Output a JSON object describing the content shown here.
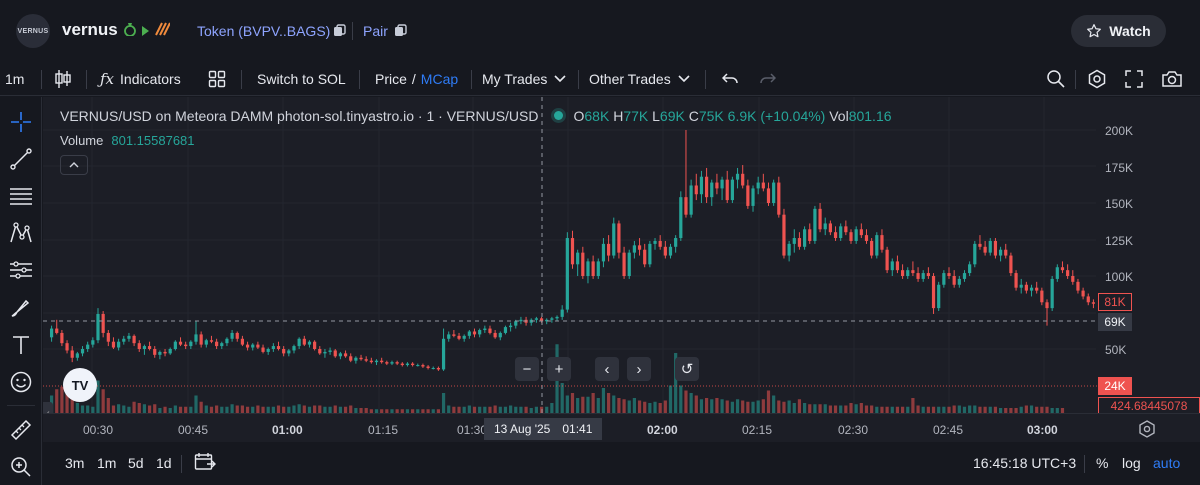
{
  "header": {
    "logo_text": "VERNUS",
    "app_name": "vernus",
    "token_label": "Token (BVPV..BAGS)",
    "pair_label": "Pair",
    "watch_label": "Watch"
  },
  "toolbar": {
    "interval": "1m",
    "indicators_label": "Indicators",
    "switch_label": "Switch to SOL",
    "price_label": "Price",
    "price_sep": "/",
    "mcap_label": "MCap",
    "my_trades_label": "My Trades",
    "other_trades_label": "Other Trades"
  },
  "legend": {
    "symbol": "VERNUS/USD on Meteora DAMM photon-sol.tinyastro.io · 1 · VERNUS/USD",
    "o_key": "O",
    "o_val": "68K",
    "h_key": "H",
    "h_val": "77K",
    "l_key": "L",
    "l_val": "69K",
    "c_key": "C",
    "c_val": "75K",
    "change": "6.9K (+10.04%)",
    "vol_key": "Vol",
    "vol_val": "801.16",
    "volume_label": "Volume",
    "volume_value": "801.15587681"
  },
  "price_axis": {
    "ticks": [
      "200K",
      "175K",
      "150K",
      "125K",
      "100K",
      "50K"
    ],
    "tag_last": "81K",
    "tag_crosshair": "69K",
    "tag_volume_price": "24K",
    "tag_volume": "424.68445078"
  },
  "time_axis": {
    "ticks": [
      "00:30",
      "00:45",
      "01:00",
      "01:15",
      "01:30",
      "02:00",
      "02:15",
      "02:30",
      "02:45",
      "03:00"
    ],
    "crosshair_date": "13 Aug '25",
    "crosshair_time": "01:41"
  },
  "nav": {
    "zoom_out": "−",
    "zoom_in": "+",
    "left": "‹",
    "right": "›",
    "reset": "↺"
  },
  "tv_logo": "TV",
  "bottombar": {
    "ranges": [
      "3m",
      "1m",
      "5d",
      "1d"
    ],
    "clock": "16:45:18 UTC+3",
    "percent": "%",
    "log": "log",
    "auto": "auto"
  },
  "colors": {
    "up": "#26a69a",
    "down": "#ef5350",
    "accent": "#2f7cf6",
    "link": "#8ea4ff"
  },
  "chart_data": {
    "type": "candlestick",
    "y_unit": "USD market cap",
    "ylim": [
      25000,
      210000
    ],
    "ohlc": [
      [
        58000,
        66000,
        55000,
        64000
      ],
      [
        64000,
        70000,
        60000,
        61000
      ],
      [
        61000,
        63000,
        52000,
        54000
      ],
      [
        54000,
        56000,
        47000,
        49000
      ],
      [
        49000,
        52000,
        41000,
        44000
      ],
      [
        44000,
        48000,
        42000,
        47000
      ],
      [
        47000,
        52000,
        45000,
        50000
      ],
      [
        50000,
        55000,
        48000,
        53000
      ],
      [
        53000,
        58000,
        51000,
        56000
      ],
      [
        56000,
        78000,
        54000,
        74000
      ],
      [
        74000,
        76000,
        58000,
        61000
      ],
      [
        61000,
        63000,
        52000,
        55000
      ],
      [
        55000,
        58000,
        50000,
        51000
      ],
      [
        51000,
        57000,
        49000,
        55000
      ],
      [
        55000,
        59000,
        53000,
        57000
      ],
      [
        57000,
        61000,
        55000,
        59000
      ],
      [
        59000,
        60000,
        52000,
        54000
      ],
      [
        54000,
        56000,
        48000,
        50000
      ],
      [
        50000,
        53000,
        46000,
        52000
      ],
      [
        52000,
        55000,
        49000,
        50000
      ],
      [
        50000,
        52000,
        44000,
        46000
      ],
      [
        46000,
        49000,
        43000,
        48000
      ],
      [
        48000,
        50000,
        45000,
        47000
      ],
      [
        47000,
        51000,
        46000,
        50000
      ],
      [
        50000,
        56000,
        49000,
        55000
      ],
      [
        55000,
        58000,
        52000,
        53000
      ],
      [
        53000,
        55000,
        50000,
        52000
      ],
      [
        52000,
        56000,
        50000,
        55000
      ],
      [
        55000,
        69000,
        53000,
        60000
      ],
      [
        60000,
        62000,
        51000,
        53000
      ],
      [
        53000,
        57000,
        51000,
        56000
      ],
      [
        56000,
        59000,
        54000,
        55000
      ],
      [
        55000,
        57000,
        50000,
        52000
      ],
      [
        52000,
        55000,
        50000,
        54000
      ],
      [
        54000,
        58000,
        52000,
        57000
      ],
      [
        57000,
        63000,
        55000,
        61000
      ],
      [
        61000,
        62000,
        55000,
        57000
      ],
      [
        57000,
        59000,
        52000,
        53000
      ],
      [
        53000,
        55000,
        49000,
        51000
      ],
      [
        51000,
        54000,
        49000,
        53000
      ],
      [
        53000,
        55000,
        50000,
        51000
      ],
      [
        51000,
        53000,
        47000,
        48000
      ],
      [
        48000,
        51000,
        46000,
        50000
      ],
      [
        50000,
        54000,
        48000,
        52000
      ],
      [
        52000,
        55000,
        49000,
        50000
      ],
      [
        50000,
        52000,
        45000,
        47000
      ],
      [
        47000,
        50000,
        45000,
        49000
      ],
      [
        49000,
        53000,
        47000,
        52000
      ],
      [
        52000,
        58000,
        50000,
        57000
      ],
      [
        57000,
        59000,
        52000,
        53000
      ],
      [
        53000,
        56000,
        51000,
        55000
      ],
      [
        55000,
        56000,
        49000,
        50000
      ],
      [
        50000,
        52000,
        46000,
        47000
      ],
      [
        47000,
        50000,
        44000,
        48000
      ],
      [
        48000,
        51000,
        46000,
        49000
      ],
      [
        49000,
        50000,
        44000,
        45000
      ],
      [
        45000,
        48000,
        43000,
        47000
      ],
      [
        47000,
        49000,
        44000,
        45000
      ],
      [
        45000,
        47000,
        41000,
        42000
      ],
      [
        42000,
        45000,
        40000,
        44000
      ],
      [
        44000,
        46000,
        42000,
        43000
      ],
      [
        43000,
        45000,
        41000,
        42000
      ],
      [
        42000,
        44000,
        40000,
        41000
      ],
      [
        41000,
        43000,
        39000,
        42000
      ],
      [
        42000,
        44000,
        40000,
        41000
      ],
      [
        41000,
        42000,
        39000,
        40000
      ],
      [
        40000,
        42000,
        39000,
        41000
      ],
      [
        41000,
        42000,
        39000,
        40000
      ],
      [
        40000,
        41000,
        38000,
        39000
      ],
      [
        39000,
        41000,
        38000,
        40000
      ],
      [
        40000,
        41000,
        38000,
        39000
      ],
      [
        39000,
        40000,
        38000,
        39000
      ],
      [
        39000,
        40000,
        37000,
        38000
      ],
      [
        38000,
        39000,
        36000,
        37000
      ],
      [
        37000,
        38000,
        36000,
        37000
      ],
      [
        37000,
        38000,
        35000,
        36000
      ],
      [
        36000,
        64000,
        35000,
        57000
      ],
      [
        57000,
        62000,
        55000,
        60000
      ],
      [
        60000,
        63000,
        58000,
        59000
      ],
      [
        59000,
        61000,
        56000,
        57000
      ],
      [
        57000,
        60000,
        55000,
        59000
      ],
      [
        59000,
        63000,
        57000,
        62000
      ],
      [
        62000,
        64000,
        58000,
        60000
      ],
      [
        60000,
        64000,
        58000,
        63000
      ],
      [
        63000,
        66000,
        61000,
        64000
      ],
      [
        64000,
        66000,
        60000,
        61000
      ],
      [
        61000,
        63000,
        57000,
        58000
      ],
      [
        58000,
        62000,
        56000,
        61000
      ],
      [
        61000,
        66000,
        60000,
        65000
      ],
      [
        65000,
        68000,
        62000,
        66000
      ],
      [
        66000,
        70000,
        64000,
        69000
      ],
      [
        69000,
        72000,
        67000,
        70000
      ],
      [
        70000,
        72000,
        66000,
        68000
      ],
      [
        68000,
        71000,
        66000,
        70000
      ],
      [
        70000,
        72000,
        68000,
        71000
      ],
      [
        71000,
        72000,
        68000,
        69000
      ],
      [
        69000,
        71000,
        67000,
        70000
      ],
      [
        70000,
        72000,
        68000,
        71000
      ],
      [
        71000,
        73000,
        69000,
        72000
      ],
      [
        72000,
        80000,
        70000,
        77000
      ],
      [
        77000,
        130000,
        75000,
        126000
      ],
      [
        126000,
        131000,
        105000,
        108000
      ],
      [
        108000,
        118000,
        100000,
        116000
      ],
      [
        116000,
        120000,
        98000,
        100000
      ],
      [
        100000,
        112000,
        95000,
        110000
      ],
      [
        110000,
        114000,
        98000,
        100000
      ],
      [
        100000,
        112000,
        98000,
        110000
      ],
      [
        110000,
        126000,
        106000,
        122000
      ],
      [
        122000,
        128000,
        110000,
        114000
      ],
      [
        114000,
        140000,
        112000,
        136000
      ],
      [
        136000,
        138000,
        112000,
        116000
      ],
      [
        116000,
        120000,
        98000,
        100000
      ],
      [
        100000,
        118000,
        98000,
        116000
      ],
      [
        116000,
        124000,
        112000,
        121000
      ],
      [
        121000,
        126000,
        114000,
        118000
      ],
      [
        118000,
        122000,
        106000,
        108000
      ],
      [
        108000,
        124000,
        106000,
        122000
      ],
      [
        122000,
        126000,
        118000,
        124000
      ],
      [
        124000,
        128000,
        118000,
        120000
      ],
      [
        120000,
        124000,
        112000,
        114000
      ],
      [
        114000,
        122000,
        112000,
        120000
      ],
      [
        120000,
        128000,
        116000,
        126000
      ],
      [
        126000,
        158000,
        124000,
        154000
      ],
      [
        154000,
        200000,
        140000,
        142000
      ],
      [
        142000,
        166000,
        140000,
        162000
      ],
      [
        162000,
        170000,
        152000,
        156000
      ],
      [
        156000,
        172000,
        150000,
        168000
      ],
      [
        168000,
        174000,
        150000,
        154000
      ],
      [
        154000,
        166000,
        148000,
        164000
      ],
      [
        164000,
        170000,
        156000,
        160000
      ],
      [
        160000,
        168000,
        152000,
        166000
      ],
      [
        166000,
        172000,
        150000,
        152000
      ],
      [
        152000,
        168000,
        150000,
        166000
      ],
      [
        166000,
        174000,
        160000,
        170000
      ],
      [
        170000,
        176000,
        160000,
        162000
      ],
      [
        162000,
        166000,
        146000,
        148000
      ],
      [
        148000,
        162000,
        144000,
        160000
      ],
      [
        160000,
        168000,
        156000,
        164000
      ],
      [
        164000,
        170000,
        158000,
        160000
      ],
      [
        160000,
        164000,
        148000,
        150000
      ],
      [
        150000,
        166000,
        148000,
        164000
      ],
      [
        164000,
        168000,
        140000,
        142000
      ],
      [
        142000,
        146000,
        112000,
        114000
      ],
      [
        114000,
        124000,
        110000,
        122000
      ],
      [
        122000,
        132000,
        116000,
        126000
      ],
      [
        126000,
        130000,
        118000,
        120000
      ],
      [
        120000,
        134000,
        118000,
        132000
      ],
      [
        132000,
        136000,
        122000,
        124000
      ],
      [
        124000,
        148000,
        122000,
        146000
      ],
      [
        146000,
        150000,
        130000,
        132000
      ],
      [
        132000,
        140000,
        128000,
        136000
      ],
      [
        136000,
        138000,
        128000,
        130000
      ],
      [
        130000,
        134000,
        124000,
        126000
      ],
      [
        126000,
        136000,
        124000,
        134000
      ],
      [
        134000,
        138000,
        128000,
        130000
      ],
      [
        130000,
        132000,
        122000,
        124000
      ],
      [
        124000,
        134000,
        122000,
        132000
      ],
      [
        132000,
        136000,
        126000,
        128000
      ],
      [
        128000,
        132000,
        122000,
        124000
      ],
      [
        124000,
        126000,
        112000,
        114000
      ],
      [
        114000,
        130000,
        112000,
        128000
      ],
      [
        128000,
        132000,
        116000,
        118000
      ],
      [
        118000,
        120000,
        102000,
        104000
      ],
      [
        104000,
        112000,
        100000,
        110000
      ],
      [
        110000,
        114000,
        102000,
        104000
      ],
      [
        104000,
        108000,
        98000,
        100000
      ],
      [
        100000,
        106000,
        98000,
        104000
      ],
      [
        104000,
        110000,
        100000,
        102000
      ],
      [
        102000,
        106000,
        96000,
        98000
      ],
      [
        98000,
        104000,
        96000,
        102000
      ],
      [
        102000,
        106000,
        98000,
        100000
      ],
      [
        100000,
        102000,
        74000,
        78000
      ],
      [
        78000,
        96000,
        76000,
        94000
      ],
      [
        94000,
        104000,
        92000,
        102000
      ],
      [
        102000,
        106000,
        98000,
        100000
      ],
      [
        100000,
        104000,
        92000,
        94000
      ],
      [
        94000,
        100000,
        92000,
        98000
      ],
      [
        98000,
        104000,
        96000,
        102000
      ],
      [
        102000,
        110000,
        100000,
        108000
      ],
      [
        108000,
        124000,
        106000,
        122000
      ],
      [
        122000,
        128000,
        118000,
        120000
      ],
      [
        120000,
        124000,
        114000,
        116000
      ],
      [
        116000,
        126000,
        114000,
        124000
      ],
      [
        124000,
        126000,
        112000,
        114000
      ],
      [
        114000,
        120000,
        110000,
        118000
      ],
      [
        118000,
        122000,
        112000,
        114000
      ],
      [
        114000,
        116000,
        100000,
        102000
      ],
      [
        102000,
        104000,
        90000,
        92000
      ],
      [
        92000,
        98000,
        88000,
        94000
      ],
      [
        94000,
        96000,
        88000,
        90000
      ],
      [
        90000,
        94000,
        86000,
        92000
      ],
      [
        92000,
        96000,
        88000,
        90000
      ],
      [
        90000,
        92000,
        80000,
        82000
      ],
      [
        82000,
        84000,
        66000,
        78000
      ],
      [
        78000,
        100000,
        76000,
        98000
      ],
      [
        98000,
        108000,
        96000,
        106000
      ],
      [
        106000,
        110000,
        102000,
        104000
      ],
      [
        104000,
        108000,
        98000,
        100000
      ],
      [
        100000,
        104000,
        94000,
        96000
      ],
      [
        96000,
        98000,
        88000,
        90000
      ],
      [
        90000,
        92000,
        84000,
        86000
      ],
      [
        86000,
        88000,
        80000,
        82000
      ],
      [
        82000,
        84000,
        78000,
        81000
      ]
    ],
    "volume": [
      14,
      19,
      21,
      23,
      11,
      8,
      6,
      6,
      5,
      26,
      19,
      12,
      6,
      7,
      6,
      5,
      9,
      8,
      7,
      6,
      7,
      4,
      5,
      4,
      6,
      5,
      5,
      5,
      14,
      9,
      6,
      5,
      6,
      5,
      5,
      7,
      6,
      6,
      5,
      5,
      6,
      5,
      5,
      5,
      6,
      5,
      5,
      6,
      7,
      6,
      5,
      6,
      6,
      5,
      5,
      6,
      5,
      5,
      6,
      4,
      4,
      4,
      3,
      3,
      3,
      3,
      3,
      3,
      3,
      3,
      3,
      3,
      3,
      3,
      3,
      3,
      16,
      6,
      5,
      5,
      5,
      6,
      5,
      5,
      5,
      5,
      6,
      5,
      5,
      6,
      5,
      5,
      5,
      4,
      5,
      5,
      5,
      8,
      55,
      24,
      14,
      16,
      12,
      13,
      13,
      16,
      12,
      20,
      16,
      14,
      12,
      11,
      10,
      12,
      10,
      9,
      8,
      9,
      8,
      10,
      22,
      48,
      22,
      18,
      16,
      14,
      11,
      12,
      11,
      12,
      11,
      10,
      9,
      11,
      10,
      9,
      9,
      10,
      11,
      18,
      14,
      10,
      9,
      10,
      8,
      11,
      8,
      7,
      7,
      7,
      7,
      6,
      6,
      6,
      6,
      8,
      7,
      8,
      6,
      6,
      5,
      5,
      5,
      5,
      5,
      5,
      5,
      12,
      6,
      5,
      5,
      5,
      5,
      5,
      5,
      6,
      6,
      5,
      6,
      6,
      5,
      5,
      5,
      5,
      4,
      4,
      4,
      4,
      5,
      6,
      6,
      5,
      5,
      5,
      4,
      4,
      4
    ]
  }
}
